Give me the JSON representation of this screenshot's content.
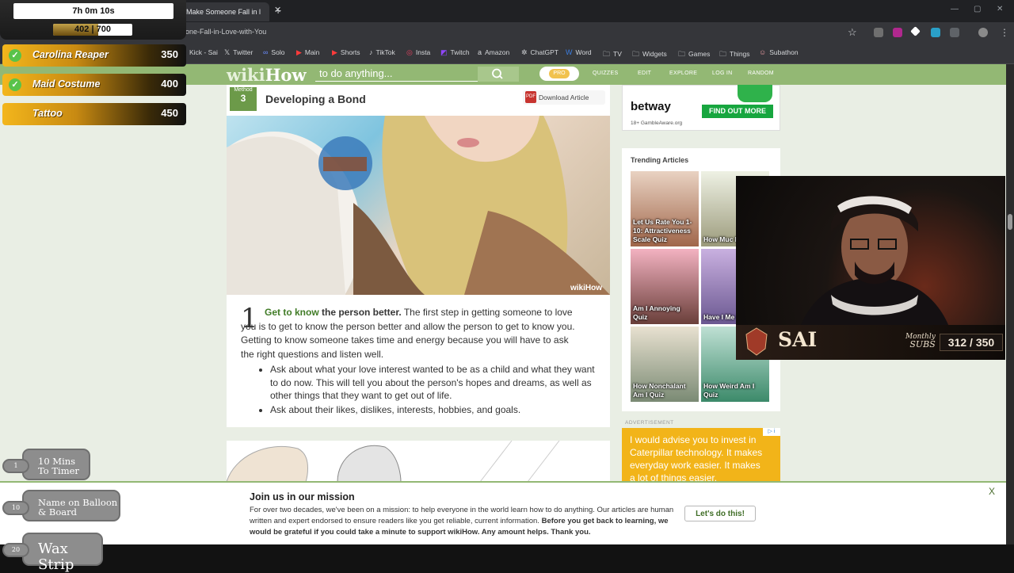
{
  "browser": {
    "tab_title": "Make Someone Fall in l",
    "url": "one-Fall-in-Love-with-You",
    "bookmarks": [
      "Kick - Sai",
      "Twitter",
      "Solo",
      "Main",
      "Shorts",
      "TikTok",
      "Insta",
      "Twitch",
      "Amazon",
      "ChatGPT",
      "Word",
      "TV",
      "Widgets",
      "Games",
      "Things",
      "Subathon"
    ]
  },
  "wikihow": {
    "search_placeholder": "to do anything...",
    "pro": "PRO",
    "nav": [
      "QUIZZES",
      "EDIT",
      "EXPLORE",
      "LOG IN",
      "RANDOM"
    ],
    "method_label": "Method",
    "method_number": "3",
    "method_title": "Developing a Bond",
    "download": "Download Article",
    "watermark": "wikiHow",
    "step_number": "1",
    "step_link": "Get to know",
    "step_lead": " the person better.",
    "step_body": " The first step in getting someone to love you is to get to know the person better and allow the person to get to know you. Getting to know someone takes time and energy because you will have to ask the right questions and listen well.",
    "bullets": [
      "Ask about what your love interest wanted to be as a child and what they want to do now. This will tell you about the person's hopes and dreams, as well as other things that they want to get out of life.",
      "Ask about their likes, dislikes, interests, hobbies, and goals."
    ],
    "ad_top": {
      "brand": "betway",
      "sub": "18+ GambleAware.org",
      "cta": "FIND OUT MORE"
    },
    "trending_title": "Trending Articles",
    "trending": [
      "Let Us Rate You 1-10: Attractiveness Scale Quiz",
      "How Muc Mog Quiz",
      "Am I Annoying Quiz",
      "Have I Me Soulmate",
      "How Nonchalant Am I Quiz",
      "How Weird Am I Quiz"
    ],
    "ad_label": "ADVERTISEMENT",
    "ad_quote": "I would advise you to invest in Caterpillar technology. It makes everyday work easier. It makes a lot of things easier."
  },
  "banner": {
    "title": "Join us in our mission",
    "body_plain": "For over two decades, we've been on a mission: to help everyone in the world learn how to do anything. Our articles are human written and expert endorsed to ensure readers like you get reliable, current information. ",
    "body_bold": "Before you get back to learning, we would be grateful if you could take a minute to support wikiHow. Any amount helps. Thank you.",
    "button": "Let's do this!",
    "close": "X"
  },
  "overlay": {
    "timer": "7h 0m 10s",
    "progress_text": "402 | 700",
    "progress_current": 402,
    "progress_goal": 700,
    "goals": [
      {
        "name": "Carolina Reaper",
        "value": "350",
        "done": true
      },
      {
        "name": "Maid Costume",
        "value": "400",
        "done": true
      },
      {
        "name": "Tattoo",
        "value": "450",
        "done": false
      }
    ],
    "redeems": [
      {
        "badge": "1",
        "label": "10 Mins To Timer"
      },
      {
        "badge": "10",
        "label": "Name on Balloon & Board"
      },
      {
        "badge": "20",
        "label": "Wax Strip"
      }
    ]
  },
  "webcam": {
    "name": "SAI",
    "subs_label_top": "Monthly",
    "subs_label_bottom": "SUBS",
    "subs_value": "312 / 350"
  }
}
